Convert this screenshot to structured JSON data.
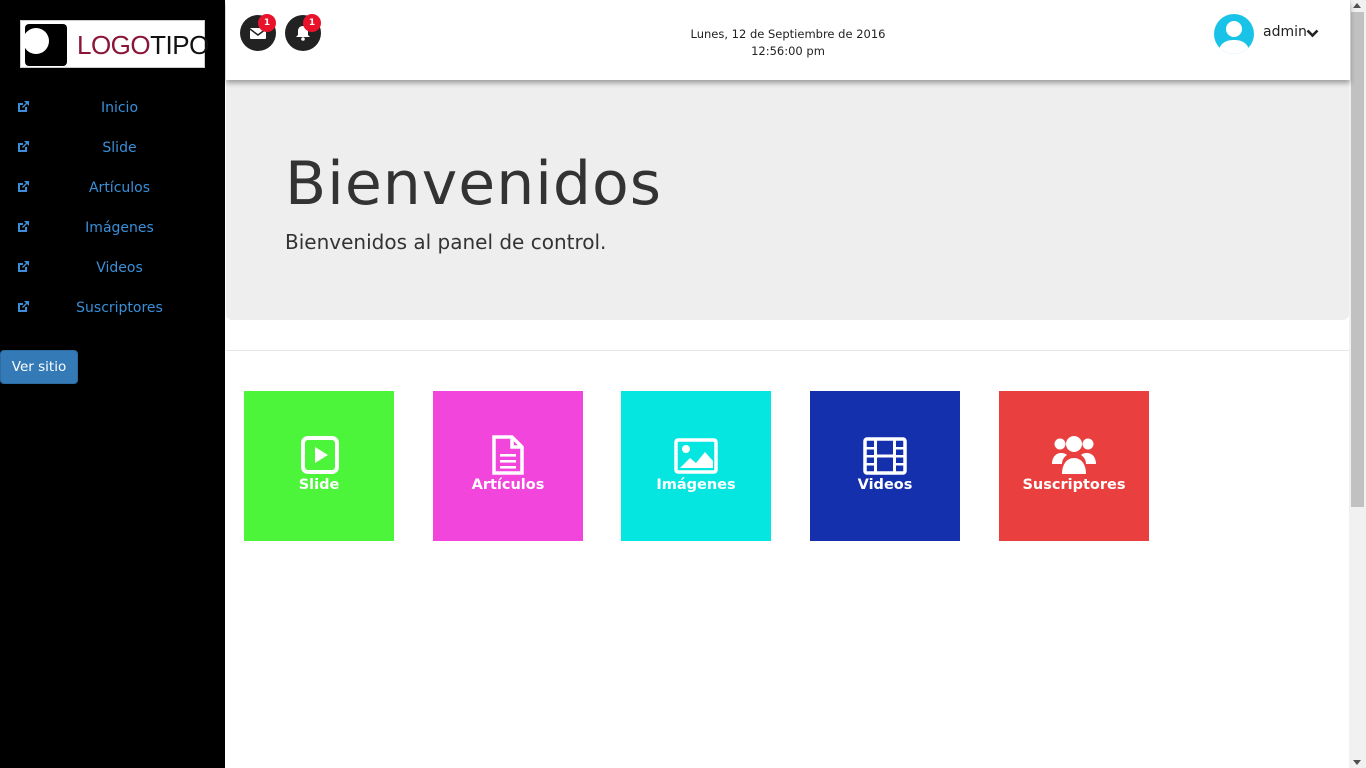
{
  "logo": {
    "text_a": "LOGO",
    "text_b": "TIPO"
  },
  "sidebar": {
    "items": [
      {
        "label": "Inicio"
      },
      {
        "label": "Slide"
      },
      {
        "label": "Artículos"
      },
      {
        "label": "Imágenes"
      },
      {
        "label": "Videos"
      },
      {
        "label": "Suscriptores"
      }
    ],
    "site_button": "Ver sitio"
  },
  "header": {
    "messages_badge": "1",
    "notifications_badge": "1",
    "date": "Lunes, 12 de Septiembre de 2016",
    "time": "12:56:00 pm",
    "user": "admin"
  },
  "jumbotron": {
    "title": "Bienvenidos",
    "subtitle": "Bienvenidos al panel de control."
  },
  "tiles": [
    {
      "label": "Slide",
      "icon": "play-square-icon",
      "color": "#4cf43a"
    },
    {
      "label": "Artículos",
      "icon": "document-icon",
      "color": "#f245dc"
    },
    {
      "label": "Imágenes",
      "icon": "image-icon",
      "color": "#06e6e0"
    },
    {
      "label": "Videos",
      "icon": "film-icon",
      "color": "#1430ac"
    },
    {
      "label": "Suscriptores",
      "icon": "users-icon",
      "color": "#ea3f3f"
    }
  ],
  "colors": {
    "sidebar_bg": "#000000",
    "link": "#3a8fd8",
    "primary_button": "#337ab7",
    "badge": "#e8132b",
    "avatar": "#19c3e8",
    "jumbotron_bg": "#eeeeee"
  }
}
